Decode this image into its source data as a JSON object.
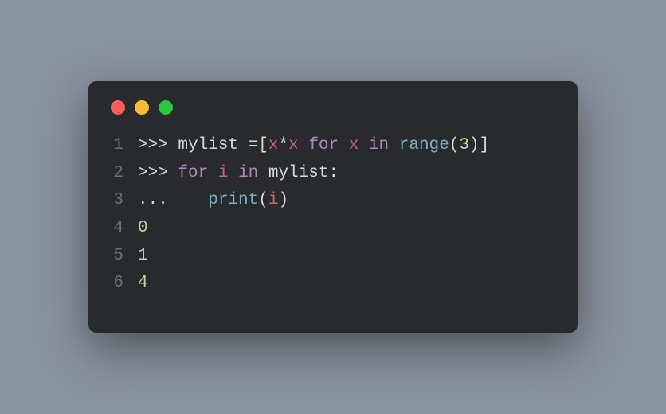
{
  "terminal": {
    "lineNumbers": [
      "1",
      "2",
      "3",
      "4",
      "5",
      "6"
    ],
    "line1": {
      "prompt": ">>> ",
      "ident_mylist": "mylist",
      "space1": " ",
      "op_eq": "=",
      "bracket_open": "[",
      "var_x1": "x",
      "op_star": "*",
      "var_x2": "x",
      "space2": " ",
      "kw_for": "for",
      "space3": " ",
      "var_x3": "x",
      "space4": " ",
      "kw_in": "in",
      "space5": " ",
      "builtin_range": "range",
      "paren_open": "(",
      "num_3": "3",
      "paren_close": ")",
      "bracket_close": "]"
    },
    "line2": {
      "prompt": ">>> ",
      "kw_for": "for",
      "space1": " ",
      "var_i": "i",
      "space2": " ",
      "kw_in": "in",
      "space3": " ",
      "ident_mylist": "mylist",
      "colon": ":"
    },
    "line3": {
      "cont": "... ",
      "indent": "   ",
      "builtin_print": "print",
      "paren_open": "(",
      "var_i": "i",
      "paren_close": ")"
    },
    "output": {
      "o1": "0",
      "o2": "1",
      "o3": "4"
    }
  }
}
